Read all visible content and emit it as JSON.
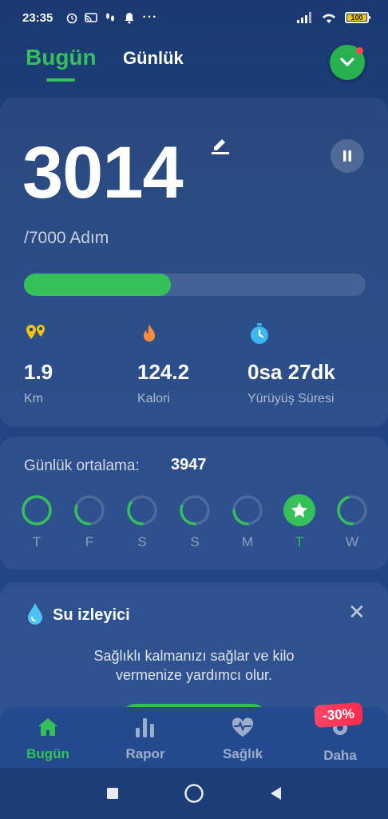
{
  "status_bar": {
    "time": "23:35",
    "battery": "100"
  },
  "header": {
    "tab_today": "Bugün",
    "tab_daily": "Günlük"
  },
  "main": {
    "steps": "3014",
    "goal": "/7000 Adım",
    "progress": 0.43,
    "stats": [
      {
        "value": "1.9",
        "label": "Km",
        "icon": "location-pins-icon"
      },
      {
        "value": "124.2",
        "label": "Kalori",
        "icon": "flame-icon"
      },
      {
        "value": "0sa 27dk",
        "label": "Yürüyüş Süresi",
        "icon": "stopwatch-icon"
      }
    ]
  },
  "weekly": {
    "title": "Günlük ortalama:",
    "value": "3947",
    "days": [
      {
        "label": "T",
        "progress": 1.0,
        "state": "ring"
      },
      {
        "label": "F",
        "progress": 0.3,
        "state": "ring"
      },
      {
        "label": "S",
        "progress": 0.35,
        "state": "ring"
      },
      {
        "label": "S",
        "progress": 0.3,
        "state": "ring"
      },
      {
        "label": "M",
        "progress": 0.25,
        "state": "ring"
      },
      {
        "label": "T",
        "progress": 1.0,
        "state": "completed"
      },
      {
        "label": "W",
        "progress": 0.45,
        "state": "ring"
      }
    ]
  },
  "water": {
    "title": "Su izleyici",
    "desc_line1": "Sağlıklı kalmanızı sağlar ve kilo",
    "desc_line2": "vermenize yardımcı olur."
  },
  "bottom_nav": {
    "items": [
      {
        "label": "Bugün",
        "icon": "home-icon",
        "active": true
      },
      {
        "label": "Rapor",
        "icon": "bar-chart-icon",
        "active": false
      },
      {
        "label": "Sağlık",
        "icon": "heart-pulse-icon",
        "active": false
      },
      {
        "label": "Daha",
        "icon": "gear-icon",
        "active": false
      }
    ],
    "promo": "-30%"
  },
  "colors": {
    "accent": "#35c05a",
    "background": "#1f4382"
  }
}
